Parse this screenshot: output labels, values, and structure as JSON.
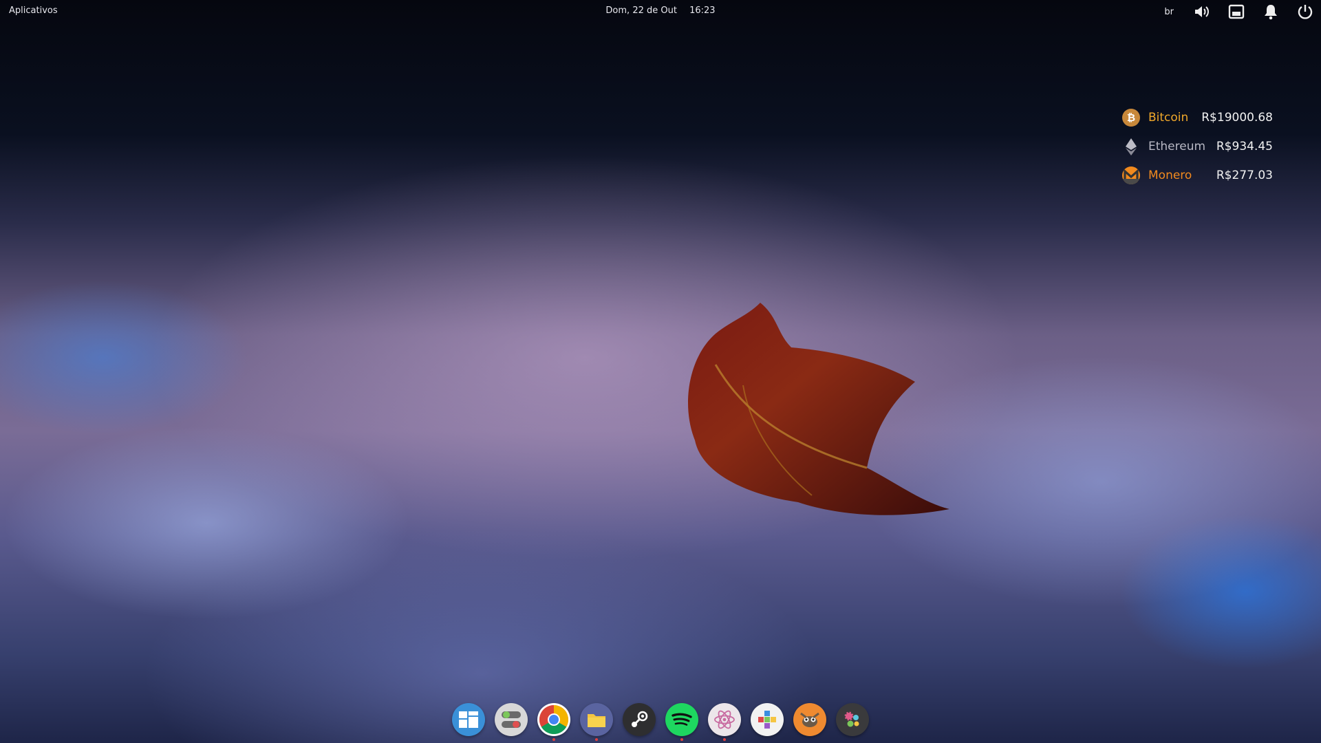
{
  "topbar": {
    "apps_label": "Aplicativos",
    "date": "Dom, 22 de Out",
    "time": "16:23",
    "keyboard_layout": "br",
    "icons": [
      "volume-icon",
      "screenshot-icon",
      "notifications-icon",
      "power-icon"
    ]
  },
  "crypto_widget": {
    "items": [
      {
        "name": "Bitcoin",
        "value": "R$19000.68",
        "icon": "bitcoin-icon",
        "color": "#f0a82a"
      },
      {
        "name": "Ethereum",
        "value": "R$934.45",
        "icon": "ethereum-icon",
        "color": "#b8b8c4"
      },
      {
        "name": "Monero",
        "value": "R$277.03",
        "icon": "monero-icon",
        "color": "#f28a1e"
      }
    ]
  },
  "dock": {
    "apps": [
      {
        "name": "multitasking-view",
        "icon": "multitasking-icon",
        "running": false
      },
      {
        "name": "system-settings",
        "icon": "settings-toggle-icon",
        "running": false
      },
      {
        "name": "chrome",
        "icon": "chrome-icon",
        "running": true
      },
      {
        "name": "files",
        "icon": "folder-icon",
        "running": true
      },
      {
        "name": "steam",
        "icon": "steam-icon",
        "running": false
      },
      {
        "name": "spotify",
        "icon": "spotify-icon",
        "running": true
      },
      {
        "name": "atom",
        "icon": "atom-icon",
        "running": true
      },
      {
        "name": "appcenter",
        "icon": "appcenter-icon",
        "running": false
      },
      {
        "name": "gimp",
        "icon": "gimp-icon",
        "running": false
      },
      {
        "name": "tweaks",
        "icon": "tweaks-icon",
        "running": false
      }
    ]
  }
}
